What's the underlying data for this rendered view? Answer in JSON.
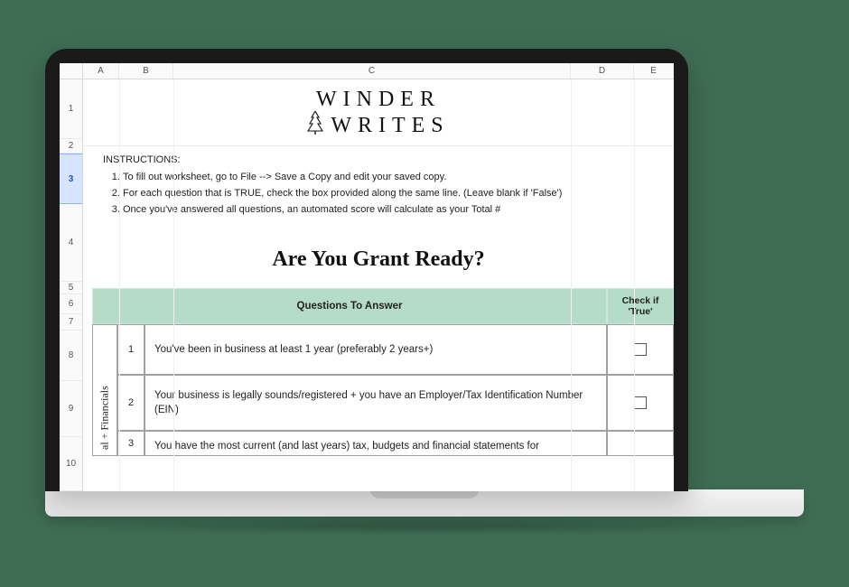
{
  "columns": {
    "A": "A",
    "B": "B",
    "C": "C",
    "D": "D",
    "E": "E"
  },
  "rows": {
    "r1": "1",
    "r2": "2",
    "r3": "3",
    "r4": "4",
    "r5": "5",
    "r6": "6",
    "r7": "7",
    "r8": "8",
    "r9": "9",
    "r10": "10"
  },
  "brand_top": "WINDER",
  "brand_bottom": "WRITES",
  "instructions_heading": "INSTRUCTIONS:",
  "instructions": {
    "i1": "To fill out worksheet, go to File --> Save a Copy and edit your saved copy.",
    "i2": "For each question that is TRUE, check the box provided along the same line. (Leave blank if 'False')",
    "i3": "Once you've answered all questions, an automated score will calculate as your Total #"
  },
  "big_question": "Are You Grant Ready?",
  "table": {
    "header_questions": "Questions To Answer",
    "header_check": "Check if 'True'",
    "side_category": "al + Financials",
    "rows": [
      {
        "n": "1",
        "q": "You've been in business at least 1 year (preferably 2 years+)"
      },
      {
        "n": "2",
        "q": "Your business is legally sounds/registered + you have an Employer/Tax Identification Number (EIN)"
      },
      {
        "n": "3",
        "q": "You have the most current (and last years) tax, budgets and financial statements for"
      }
    ]
  }
}
